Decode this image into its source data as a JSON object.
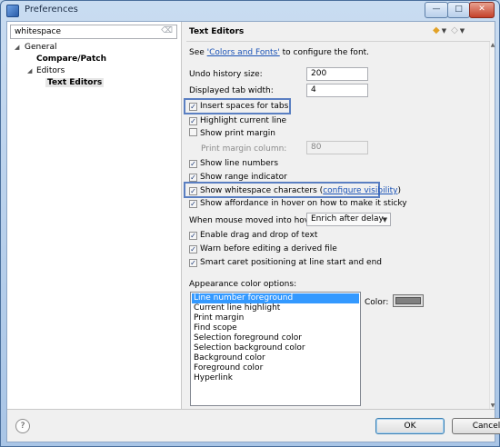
{
  "window": {
    "title": "Preferences"
  },
  "filter": {
    "value": "whitespace"
  },
  "tree": {
    "general": "General",
    "compare_patch": "Compare/Patch",
    "editors": "Editors",
    "text_editors": "Text Editors"
  },
  "page": {
    "title": "Text Editors",
    "font_hint_pre": "See ",
    "font_hint_link": "'Colors and Fonts'",
    "font_hint_post": " to configure the font.",
    "undo_label": "Undo history size:",
    "undo_value": "200",
    "tab_width_label": "Displayed tab width:",
    "tab_width_value": "4",
    "insert_spaces": "Insert spaces for tabs",
    "highlight_line": "Highlight current line",
    "show_print_margin": "Show print margin",
    "print_margin_col_label": "Print margin column:",
    "print_margin_col_value": "80",
    "show_line_numbers": "Show line numbers",
    "show_range": "Show range indicator",
    "show_whitespace_pre": "Show whitespace characters (",
    "show_whitespace_link": "configure visibility",
    "show_whitespace_post": ")",
    "show_affordance": "Show affordance in hover on how to make it sticky",
    "hover_label": "When mouse moved into hover:",
    "hover_value": "Enrich after delay",
    "drag_drop": "Enable drag and drop of text",
    "warn_derived": "Warn before editing a derived file",
    "smart_caret": "Smart caret positioning at line start and end",
    "appearance_label": "Appearance color options:",
    "color_label": "Color:",
    "color_options": [
      "Line number foreground",
      "Current line highlight",
      "Print margin",
      "Find scope",
      "Selection foreground color",
      "Selection background color",
      "Background color",
      "Foreground color",
      "Hyperlink"
    ],
    "selected_color_hex": "#808080"
  },
  "checks": {
    "checked_glyph": "✓"
  },
  "icons": {
    "back": "◆",
    "forward": "◇",
    "dropdown": "▼",
    "close": "✕",
    "minimize": "—",
    "maximize": "□",
    "help": "?",
    "clear": "⌫",
    "tree_expand": "◢",
    "scroll_up": "▲",
    "scroll_down": "▼"
  },
  "buttons": {
    "ok": "OK",
    "cancel": "Cancel"
  },
  "colors": {
    "accent": "#3399ff",
    "highlight_frame": "#5a7fc2",
    "link": "#1a52b6"
  }
}
